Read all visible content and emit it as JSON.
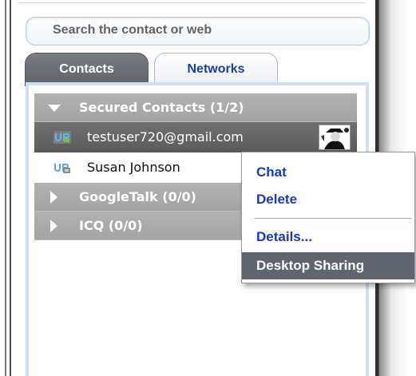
{
  "search": {
    "placeholder": "Search the contact or web"
  },
  "tabs": [
    {
      "label": "Contacts",
      "active": true
    },
    {
      "label": "Networks",
      "active": false
    }
  ],
  "contact_list": {
    "groups": [
      {
        "label": "Secured Contacts (1/2)",
        "expanded": true,
        "contacts": [
          {
            "label": "testuser720@gmail.com",
            "selected": true,
            "icon": "user-status-online-icon"
          },
          {
            "label": "Susan Johnson",
            "selected": false,
            "icon": "user-status-offline-icon"
          }
        ]
      },
      {
        "label": "GoogleTalk (0/0)",
        "expanded": false
      },
      {
        "label": "ICQ (0/0)",
        "expanded": false
      }
    ]
  },
  "context_menu": {
    "items": [
      {
        "label": "Chat",
        "highlighted": false
      },
      {
        "label": "Delete",
        "highlighted": false
      },
      {
        "label": "Details...",
        "highlighted": false
      },
      {
        "label": "Desktop Sharing",
        "highlighted": true
      }
    ]
  },
  "colors": {
    "tab_active": "#5f6169",
    "tab_inactive_text": "#1f3f9f",
    "group_header": "#a3a3a3",
    "selected_row": "#5a5a5a",
    "menu_text": "#1a3cb2",
    "menu_highlight": "#5e6470"
  }
}
